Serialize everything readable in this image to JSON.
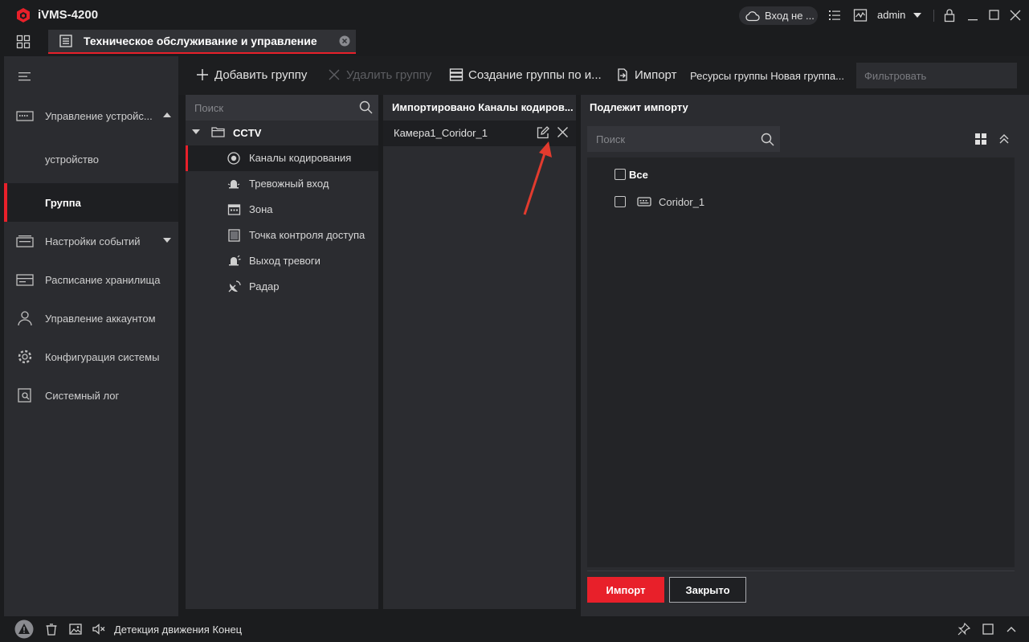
{
  "app": {
    "title": "iVMS-4200"
  },
  "header": {
    "cloud_login": "Вход не ...",
    "user": "admin"
  },
  "tab": {
    "title": "Техническое обслуживание и управление"
  },
  "sidebar": {
    "items": [
      {
        "label": "Управление устройс...",
        "icon": "device-manager-icon"
      },
      {
        "label": "устройство",
        "icon": ""
      },
      {
        "label": "Группа",
        "icon": ""
      },
      {
        "label": "Настройки событий",
        "icon": "event-settings-icon"
      },
      {
        "label": "Расписание хранилища",
        "icon": "storage-schedule-icon"
      },
      {
        "label": "Управление аккаунтом",
        "icon": "account-icon"
      },
      {
        "label": "Конфигурация системы",
        "icon": "gear-icon"
      },
      {
        "label": "Системный лог",
        "icon": "system-log-icon"
      }
    ]
  },
  "toolbar": {
    "add_group": "Добавить группу",
    "delete_group": "Удалить группу",
    "create_group": "Создание группы по и...",
    "import": "Импорт",
    "resources": "Ресурсы группы Новая группа...",
    "filter_placeholder": "Фильтровать"
  },
  "tree": {
    "search_placeholder": "Поиск",
    "root": "CCTV",
    "items": [
      {
        "label": "Каналы кодирования",
        "icon": "encoding-channel-icon"
      },
      {
        "label": "Тревожный вход",
        "icon": "alarm-input-icon"
      },
      {
        "label": "Зона",
        "icon": "zone-icon"
      },
      {
        "label": "Точка контроля доступа",
        "icon": "access-point-icon"
      },
      {
        "label": "Выход тревоги",
        "icon": "alarm-output-icon"
      },
      {
        "label": "Радар",
        "icon": "radar-icon"
      }
    ]
  },
  "imported": {
    "title": "Импортировано Каналы кодиров...",
    "items": [
      "Камера1_Coridor_1"
    ]
  },
  "pending": {
    "title": "Подлежит импорту",
    "search_placeholder": "Поиск",
    "select_all": "Все",
    "items": [
      "Coridor_1"
    ],
    "import_button": "Импорт",
    "close_button": "Закрыто"
  },
  "status": {
    "text": "Детекция движения Конец"
  },
  "colors": {
    "accent": "#e8202a",
    "panel": "#2b2c30",
    "background": "#1b1c1e"
  }
}
